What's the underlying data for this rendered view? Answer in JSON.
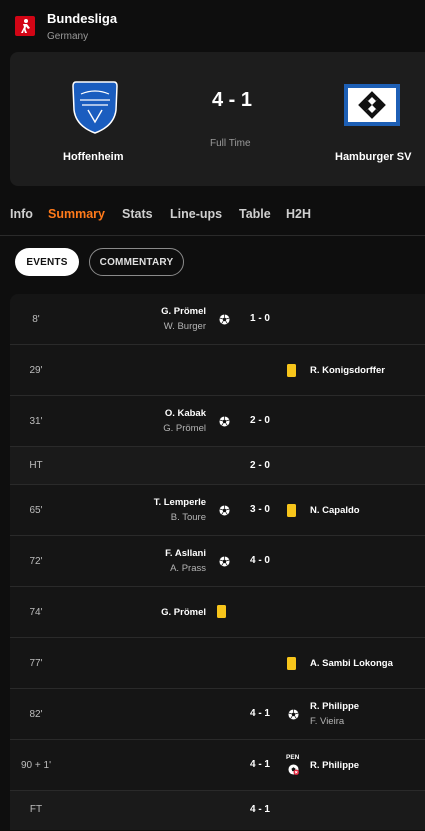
{
  "league": {
    "name": "Bundesliga",
    "country": "Germany",
    "logo_icon": "bundesliga-logo-icon"
  },
  "match": {
    "home": {
      "name": "Hoffenheim",
      "crest_icon": "hoffenheim-crest-icon"
    },
    "away": {
      "name": "Hamburger SV",
      "crest_icon": "hamburg-crest-icon"
    },
    "score": "4 - 1",
    "status": "Full Time"
  },
  "tabs": [
    {
      "label": "Info",
      "active": false
    },
    {
      "label": "Summary",
      "active": true
    },
    {
      "label": "Stats",
      "active": false
    },
    {
      "label": "Line-ups",
      "active": false
    },
    {
      "label": "Table",
      "active": false
    },
    {
      "label": "H2H",
      "active": false
    }
  ],
  "subtabs": {
    "events": "EVENTS",
    "commentary": "COMMENTARY",
    "active": "events"
  },
  "events": [
    {
      "minute": "8'",
      "home_player": "G. Prömel",
      "home_assist": "W. Burger",
      "home_icon": "goal-ball-icon",
      "score": "1 - 0"
    },
    {
      "minute": "29'",
      "away_player": "R. Konigsdorffer",
      "away_icon": "yellow-card-icon"
    },
    {
      "minute": "31'",
      "home_player": "O. Kabak",
      "home_assist": "G. Prömel",
      "home_icon": "goal-ball-icon",
      "score": "2 - 0"
    },
    {
      "minute": "HT",
      "score": "2 - 0"
    },
    {
      "minute": "65'",
      "home_player": "T. Lemperle",
      "home_assist": "B. Toure",
      "home_icon": "goal-ball-icon",
      "score": "3 - 0",
      "away_player": "N. Capaldo",
      "away_icon": "yellow-card-icon"
    },
    {
      "minute": "72'",
      "home_player": "F. Asllani",
      "home_assist": "A. Prass",
      "home_icon": "goal-ball-icon",
      "score": "4 - 0"
    },
    {
      "minute": "74'",
      "home_player": "G. Prömel",
      "home_icon": "yellow-card-icon"
    },
    {
      "minute": "77'",
      "away_player": "A. Sambi Lokonga",
      "away_icon": "yellow-card-icon"
    },
    {
      "minute": "82'",
      "score": "4 - 1",
      "away_player": "R. Philippe",
      "away_assist": "F. Vieira",
      "away_icon": "goal-ball-icon"
    },
    {
      "minute": "90 + 1'",
      "score": "4 - 1",
      "away_player": "R. Philippe",
      "away_icon": "penalty-missed-icon",
      "away_icon_label": "PEN"
    },
    {
      "minute": "FT",
      "score": "4 - 1"
    }
  ],
  "colors": {
    "accent": "#ff7a1a",
    "yellow_card": "#f7c51b",
    "background": "#0e0e0e",
    "card": "#1d1d1d"
  }
}
